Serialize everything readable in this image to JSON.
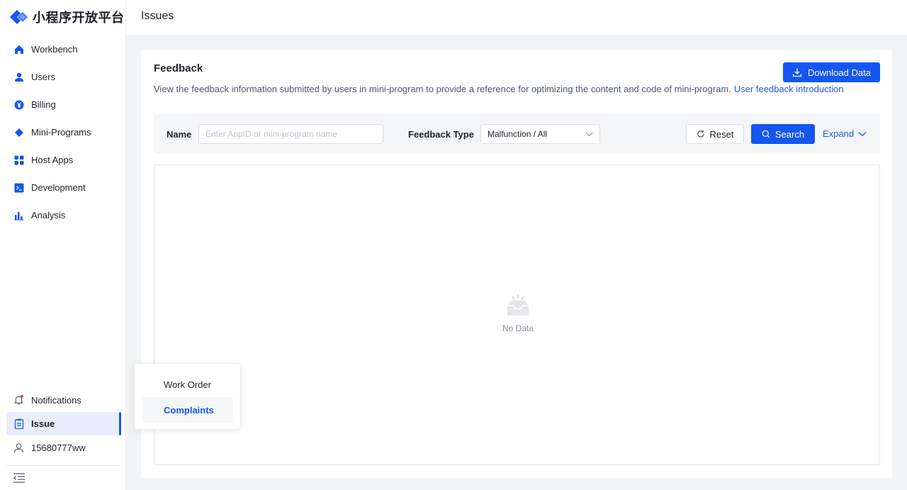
{
  "app": {
    "brand": "小程序开放平台"
  },
  "header": {
    "title": "Issues"
  },
  "sidebar": {
    "items": [
      {
        "label": "Workbench",
        "icon": "home-icon"
      },
      {
        "label": "Users",
        "icon": "user-icon"
      },
      {
        "label": "Billing",
        "icon": "yen-icon"
      },
      {
        "label": "Mini-Programs",
        "icon": "diamond-icon"
      },
      {
        "label": "Host Apps",
        "icon": "grid-icon"
      },
      {
        "label": "Development",
        "icon": "terminal-icon"
      },
      {
        "label": "Analysis",
        "icon": "bar-chart-icon"
      }
    ],
    "bottom": [
      {
        "label": "Notifications",
        "icon": "bell-icon"
      },
      {
        "label": "Issue",
        "icon": "clipboard-icon"
      },
      {
        "label": "15680777ww",
        "icon": "account-icon"
      }
    ]
  },
  "card": {
    "title": "Feedback",
    "description": "View the feedback information submitted by users in mini-program to provide a reference for optimizing the content and code of mini-program.",
    "link": "User feedback introduction",
    "download_label": "Download Data"
  },
  "filter": {
    "name_label": "Name",
    "name_placeholder": "Enter AppID or mini-program name",
    "type_label": "Feedback Type",
    "type_value": "Malfunction / All",
    "reset_label": "Reset",
    "search_label": "Search",
    "expand_label": "Expand"
  },
  "table": {
    "empty_text": "No Data"
  },
  "popover": {
    "items": [
      {
        "label": "Work Order",
        "selected": false
      },
      {
        "label": "Complaints",
        "selected": true
      }
    ]
  },
  "colors": {
    "primary": "#1456f0",
    "link": "#2457e6",
    "active_bg": "#e8edfc",
    "notification_dot": "#f53f3f"
  }
}
